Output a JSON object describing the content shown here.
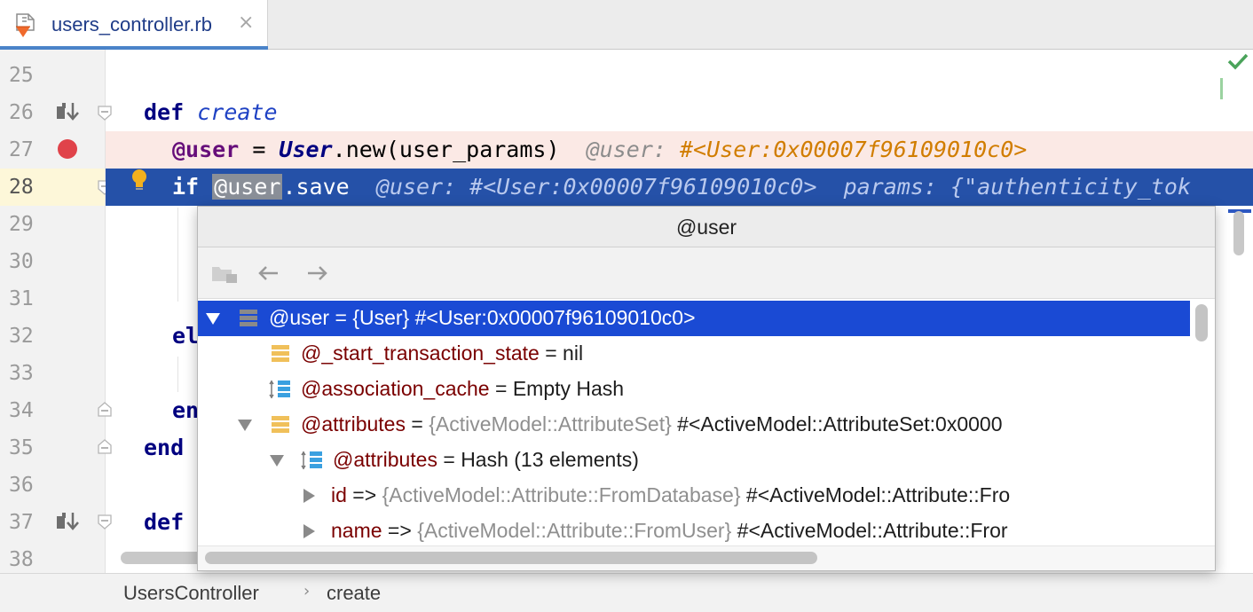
{
  "tab": {
    "label": "users_controller.rb",
    "close": "×"
  },
  "gutter": {
    "lines": [
      "25",
      "26",
      "27",
      "28",
      "29",
      "30",
      "31",
      "32",
      "33",
      "34",
      "35",
      "36",
      "37",
      "38"
    ]
  },
  "code": {
    "line26": {
      "kw": "def",
      "fn": "create"
    },
    "line27": {
      "ivar": "@user",
      "eq": " = ",
      "cls": "User",
      "rest": ".new(user_params)",
      "inline_key": "@user: ",
      "inline_val": "#<User:0x00007f96109010c0>"
    },
    "line28": {
      "kw": "if",
      "sel": "@user",
      "rest": ".save",
      "inline1": "@user: #<User:0x00007f96109010c0>",
      "inline2": "params: {\"authenticity_tok"
    },
    "line32": {
      "kw": "el"
    },
    "line34": {
      "kw": "en"
    },
    "line35": {
      "kw": "end"
    },
    "line37": {
      "kw": "def"
    }
  },
  "breadcrumb": {
    "items": [
      "UsersController",
      "create"
    ],
    "separator": "›"
  },
  "popup": {
    "title": "@user",
    "rows": [
      {
        "name": "@user",
        "op": " = ",
        "type": "{User}",
        "val": " #<User:0x00007f96109010c0>"
      },
      {
        "name": "@_start_transaction_state",
        "op": " = ",
        "type": "",
        "val": "nil"
      },
      {
        "name": "@association_cache",
        "op": " = ",
        "type": "",
        "val": "Empty Hash"
      },
      {
        "name": "@attributes",
        "op": " = ",
        "type": "{ActiveModel::AttributeSet}",
        "val": " #<ActiveModel::AttributeSet:0x0000"
      },
      {
        "name": "@attributes",
        "op": " = ",
        "type": "",
        "val": "Hash (13 elements)"
      },
      {
        "name": "id",
        "op": " => ",
        "type": "{ActiveModel::Attribute::FromDatabase}",
        "val": " #<ActiveModel::Attribute::Fro"
      },
      {
        "name": "name",
        "op": " => ",
        "type": "{ActiveModel::Attribute::FromUser}",
        "val": " #<ActiveModel::Attribute::Fror"
      }
    ]
  },
  "colors": {
    "selection": "#1a4ad4",
    "current_line": "#2551a8",
    "breakpoint": "#e0434a",
    "execution_line": "#fbe9e5"
  }
}
